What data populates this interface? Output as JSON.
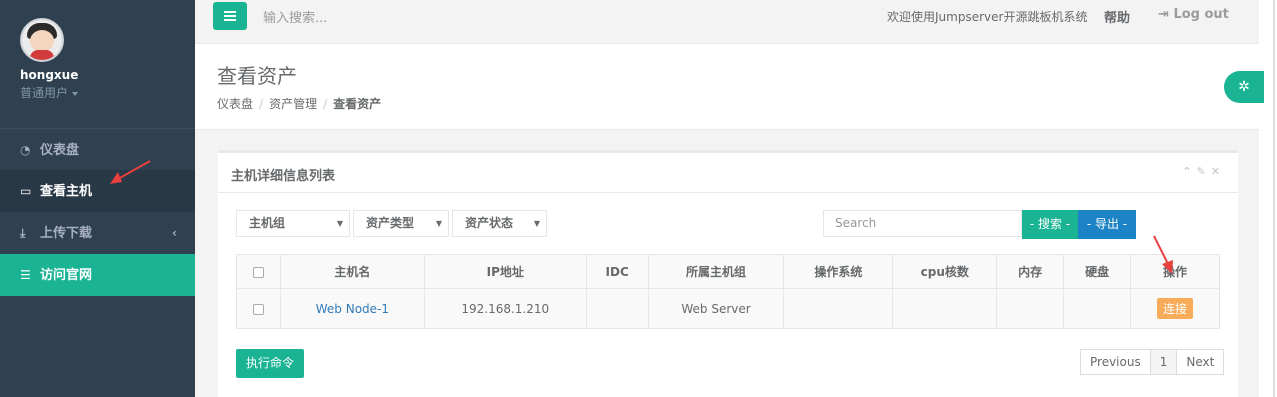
{
  "sidebar": {
    "user": {
      "name": "hongxue",
      "role": "普通用户"
    },
    "items": [
      {
        "label": "仪表盘"
      },
      {
        "label": "查看主机"
      },
      {
        "label": "上传下载"
      },
      {
        "label": "访问官网"
      }
    ]
  },
  "topbar": {
    "search_placeholder": "输入搜索...",
    "welcome": "欢迎使用Jumpserver开源跳板机系统",
    "help": "帮助",
    "logout": "Log out"
  },
  "page": {
    "title": "查看资产",
    "breadcrumb": [
      "仪表盘",
      "资产管理",
      "查看资产"
    ]
  },
  "panel": {
    "title": "主机详细信息列表",
    "filters": [
      "主机组",
      "资产类型",
      "资产状态"
    ],
    "search_placeholder": "Search",
    "search_btn": "- 搜索 -",
    "export_btn": "- 导出 -",
    "columns": [
      "主机名",
      "IP地址",
      "IDC",
      "所属主机组",
      "操作系统",
      "cpu核数",
      "内存",
      "硬盘",
      "操作"
    ],
    "rows": [
      {
        "hostname": "Web Node-1",
        "ip": "192.168.1.210",
        "idc": "",
        "group": "Web Server",
        "os": "",
        "cpu": "",
        "mem": "",
        "disk": "",
        "action": "连接"
      }
    ],
    "exec_btn": "执行命令",
    "pager": {
      "prev": "Previous",
      "page": "1",
      "next": "Next"
    }
  },
  "colors": {
    "accent": "#1ab394",
    "sidebar": "#2f4050",
    "primary": "#1c84c6",
    "warning": "#f8ac59",
    "annotation": "#e8403f"
  }
}
